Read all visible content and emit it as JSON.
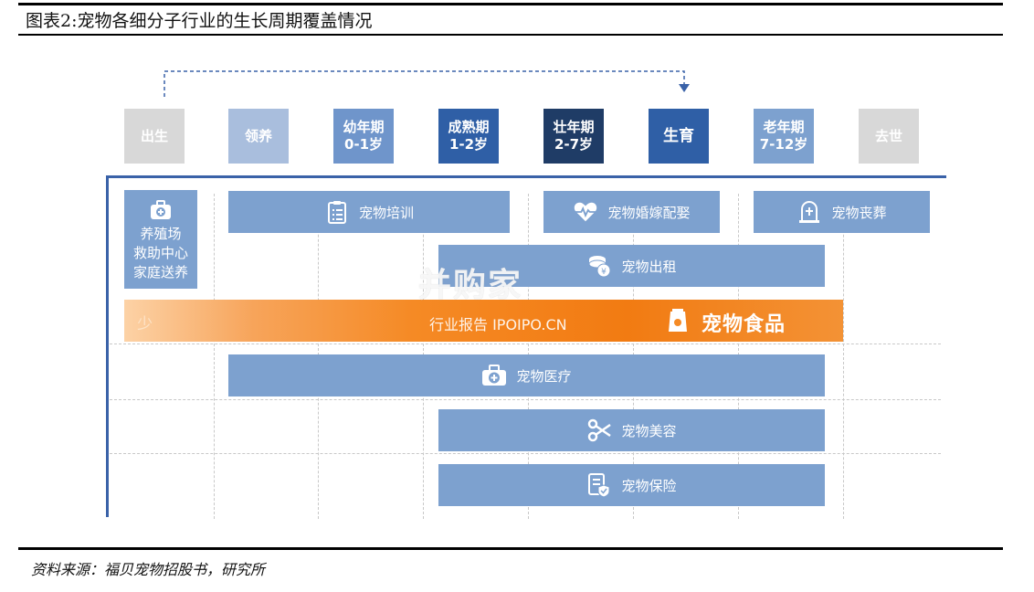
{
  "title": "图表2:宠物各细分子行业的生长周期覆盖情况",
  "source": "资料来源：福贝宠物招股书，研究所",
  "stages": [
    {
      "line1": "出生",
      "line2": "",
      "color": "#d8d8d8"
    },
    {
      "line1": "领养",
      "line2": "",
      "color": "#a9bedd"
    },
    {
      "line1": "幼年期",
      "line2": "0-1岁",
      "color": "#6f95cb"
    },
    {
      "line1": "成熟期",
      "line2": "1-2岁",
      "color": "#2f5fa6"
    },
    {
      "line1": "壮年期",
      "line2": "2-7岁",
      "color": "#1f3c66"
    },
    {
      "line1": "生育",
      "line2": "",
      "color": "#2f5fa6"
    },
    {
      "line1": "老年期",
      "line2": "7-12岁",
      "color": "#7da1cf"
    },
    {
      "line1": "去世",
      "line2": "",
      "color": "#d8d8d8"
    }
  ],
  "services": {
    "breeding": {
      "line1": "养殖场",
      "line2": "救助中心",
      "line3": "家庭送养",
      "icon": "medical-kit-icon"
    },
    "training": {
      "label": "宠物培训",
      "icon": "clipboard-icon"
    },
    "wedding": {
      "label": "宠物婚嫁配娶",
      "icon": "heartbeat-icon"
    },
    "funeral": {
      "label": "宠物丧葬",
      "icon": "tombstone-icon"
    },
    "rental": {
      "label": "宠物出租",
      "icon": "coins-icon"
    },
    "food": {
      "label": "宠物食品",
      "icon": "food-bag-icon",
      "side": "少"
    },
    "medical": {
      "label": "宠物医疗",
      "icon": "medical-kit-icon"
    },
    "grooming": {
      "label": "宠物美容",
      "icon": "scissors-icon"
    },
    "insurance": {
      "label": "宠物保险",
      "icon": "insurance-doc-icon"
    }
  },
  "watermark": {
    "main": "并购家",
    "sub": "行业报告 IPOIPO.CN"
  },
  "colors": {
    "accent": "#2f5fa6",
    "bar": "#7da1cf",
    "orange": "#f27b12",
    "axis": "#3a62a8"
  }
}
